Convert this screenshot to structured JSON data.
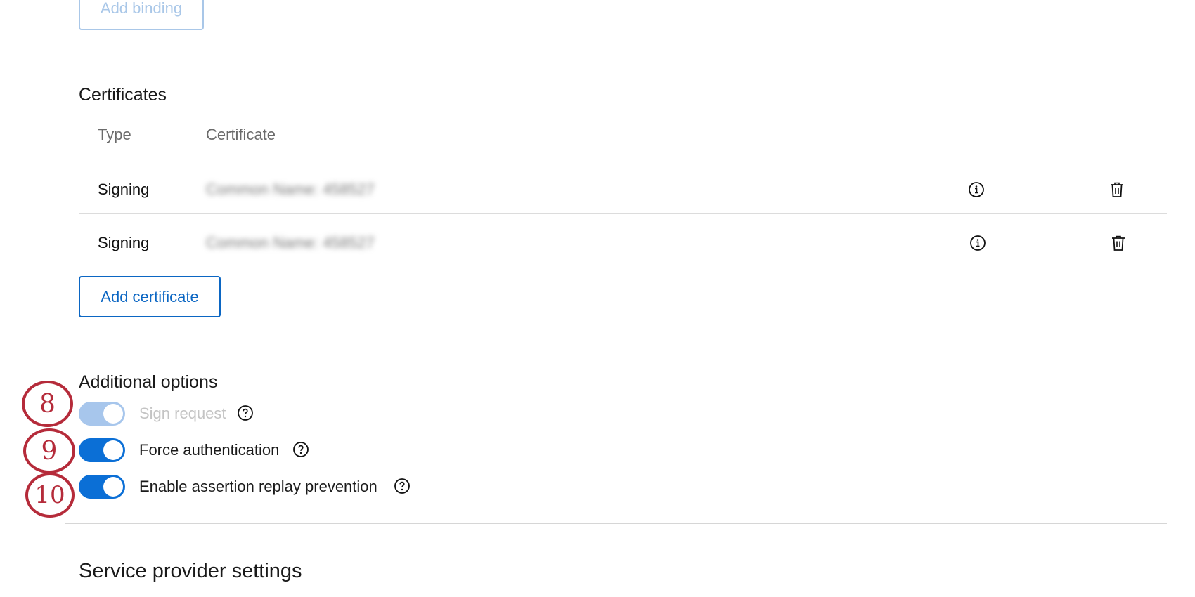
{
  "bindings": {
    "add_binding_label": "Add binding"
  },
  "certificates": {
    "title": "Certificates",
    "columns": [
      "Type",
      "Certificate"
    ],
    "rows": [
      {
        "type": "Signing",
        "certificate": "Common Name: 458527",
        "info_icon": "info-icon",
        "delete_icon": "trash-icon"
      },
      {
        "type": "Signing",
        "certificate": "Common Name: 458527",
        "info_icon": "info-icon",
        "delete_icon": "trash-icon"
      }
    ],
    "add_certificate_label": "Add certificate"
  },
  "additional_options": {
    "title": "Additional options",
    "options": [
      {
        "label": "Sign request",
        "enabled": true,
        "disabled": true,
        "annotation": "8",
        "help_icon": "question-circle-icon"
      },
      {
        "label": "Force authentication",
        "enabled": true,
        "disabled": false,
        "annotation": "9",
        "help_icon": "question-circle-icon"
      },
      {
        "label": "Enable assertion replay prevention",
        "enabled": true,
        "disabled": false,
        "annotation": "10",
        "help_icon": "question-circle-icon"
      }
    ]
  },
  "service_provider": {
    "title": "Service provider settings"
  },
  "colors": {
    "accent": "#0b66c3",
    "toggle_on": "#0b6fd6",
    "toggle_disabled": "#a7c6ec",
    "annotation": "#b52b3a"
  }
}
